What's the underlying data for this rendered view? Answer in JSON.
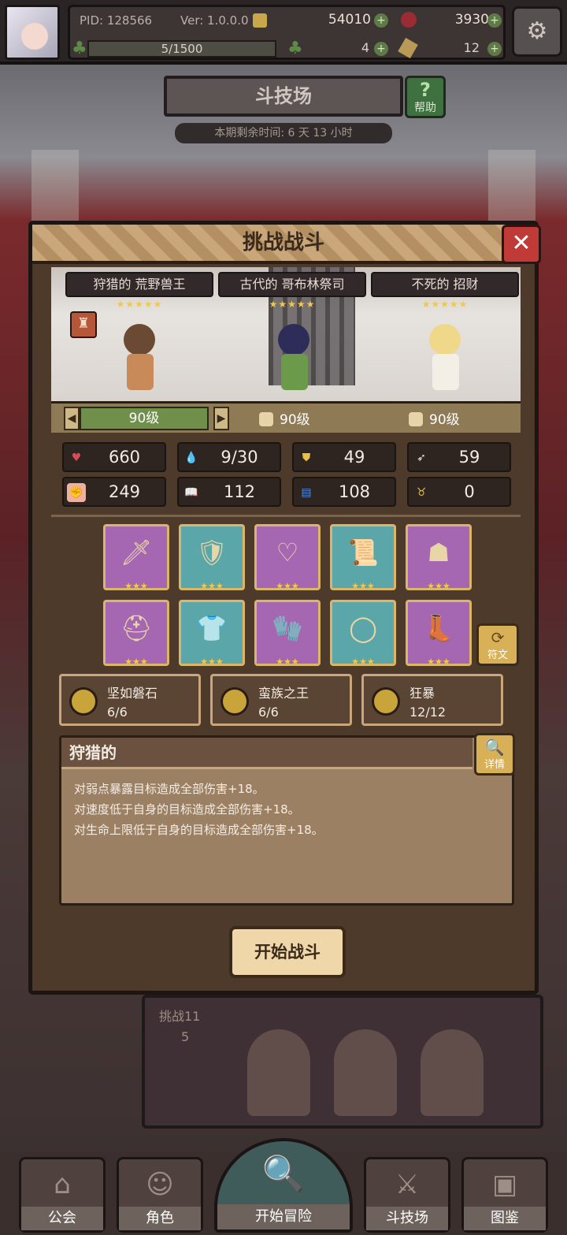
{
  "topbar": {
    "pid": "PID: 128566",
    "version": "Ver: 1.0.0.0",
    "gold": "54010",
    "ruby": "3930",
    "stamina": "5/1500",
    "clover": "4",
    "ticket": "12",
    "plus_symbol": "+",
    "settings_icon": "⚙"
  },
  "arena": {
    "title": "斗技场",
    "help_label": "帮助",
    "help_icon": "?",
    "season_remaining": "本期剩余时间: 6 天 13 小时"
  },
  "dialog": {
    "title": "挑战战斗",
    "close_icon": "✕",
    "enemies": [
      {
        "name": "狩猎的 荒野兽王",
        "stars": "★★★★★",
        "level": "90级"
      },
      {
        "name": "古代的 哥布林祭司",
        "stars": "★★★★★",
        "level": "90级"
      },
      {
        "name": "不死的 招财",
        "stars": "★★★★★",
        "level": "90级"
      }
    ],
    "tower_icon": "♜",
    "arrow_left": "◀",
    "arrow_right": "▶",
    "stats": [
      {
        "icon": "♥",
        "value": "660",
        "icon_color": "#d64a5a"
      },
      {
        "icon": "💧",
        "value": "9/30",
        "icon_color": "#6ab7e0"
      },
      {
        "icon": "⛊",
        "value": "49",
        "icon_color": "#e8c04a"
      },
      {
        "icon": "➶",
        "value": "59",
        "icon_color": "#e8e8f0"
      },
      {
        "icon": "✊",
        "value": "249",
        "icon_color": "#e07a7a"
      },
      {
        "icon": "📖",
        "value": "112",
        "icon_color": "#7ab0e8"
      },
      {
        "icon": "▤",
        "value": "108",
        "icon_color": "#5a8ad8"
      },
      {
        "icon": "♉",
        "value": "0",
        "icon_color": "#e8c04a"
      }
    ],
    "equipment_stars": "★★★",
    "equipment_row1": [
      {
        "icon": "🗡",
        "bg": "purple"
      },
      {
        "icon": "🛡",
        "bg": "cyan"
      },
      {
        "icon": "♡",
        "bg": "purple"
      },
      {
        "icon": "📜",
        "bg": "cyan"
      },
      {
        "icon": "☗",
        "bg": "purple"
      }
    ],
    "equipment_row2": [
      {
        "icon": "⛑",
        "bg": "purple"
      },
      {
        "icon": "👕",
        "bg": "cyan"
      },
      {
        "icon": "🧤",
        "bg": "purple"
      },
      {
        "icon": "◯",
        "bg": "cyan"
      },
      {
        "icon": "👢",
        "bg": "purple"
      }
    ],
    "rune_label": "符文",
    "rune_icon": "⟳",
    "sets": [
      {
        "name": "坚如磐石",
        "count": "6/6"
      },
      {
        "name": "蛮族之王",
        "count": "6/6"
      },
      {
        "name": "狂暴",
        "count": "12/12"
      }
    ],
    "trait": {
      "title": "狩猎的",
      "detail_label": "详情",
      "detail_icon": "🔍",
      "lines": [
        "对弱点暴露目标造成全部伤害+18。",
        "对速度低于自身的目标造成全部伤害+18。",
        "对生命上限低于自身的目标造成全部伤害+18。"
      ]
    },
    "start_button": "开始战斗"
  },
  "background": {
    "challenge_label": "挑战11",
    "challenge_cost": "5"
  },
  "nav": {
    "guild": "公会",
    "character": "角色",
    "adventure": "开始冒险",
    "arena": "斗技场",
    "codex": "图鉴",
    "guild_icon": "⌂",
    "character_icon": "☺",
    "adventure_icon": "🔍",
    "arena_icon": "⚔",
    "codex_icon": "▣"
  }
}
